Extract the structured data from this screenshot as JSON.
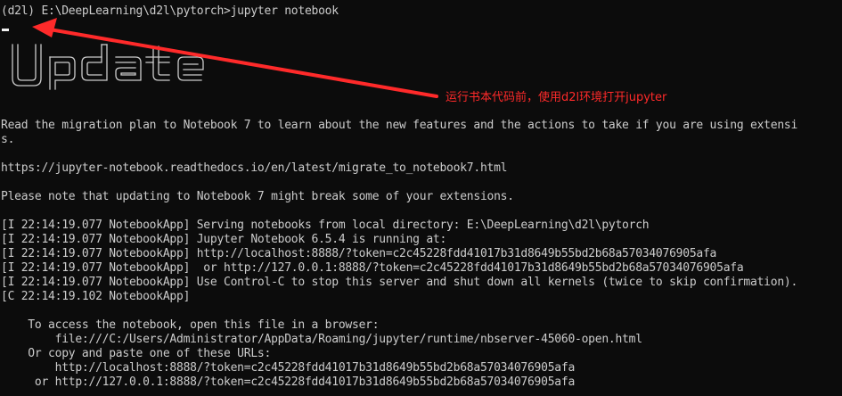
{
  "terminal": {
    "lines": {
      "prompt": "(d2l) E:\\DeepLearning\\d2l\\pytorch>jupyter notebook",
      "migration_1": "Read the migration plan to Notebook 7 to learn about the new features and the actions to take if you are using extensi",
      "migration_2": "s.",
      "docs_url": "https://jupyter-notebook.readthedocs.io/en/latest/migrate_to_notebook7.html",
      "warning": "Please note that updating to Notebook 7 might break some of your extensions.",
      "log_1": "[I 22:14:19.077 NotebookApp] Serving notebooks from local directory: E:\\DeepLearning\\d2l\\pytorch",
      "log_2": "[I 22:14:19.077 NotebookApp] Jupyter Notebook 6.5.4 is running at:",
      "log_3": "[I 22:14:19.077 NotebookApp] http://localhost:8888/?token=c2c45228fdd41017b31d8649b55bd2b68a57034076905afa",
      "log_4": "[I 22:14:19.077 NotebookApp]  or http://127.0.0.1:8888/?token=c2c45228fdd41017b31d8649b55bd2b68a57034076905afa",
      "log_5": "[I 22:14:19.077 NotebookApp] Use Control-C to stop this server and shut down all kernels (twice to skip confirmation).",
      "log_6": "[C 22:14:19.102 NotebookApp]",
      "access_1": "    To access the notebook, open this file in a browser:",
      "access_2": "        file:///C:/Users/Administrator/AppData/Roaming/jupyter/runtime/nbserver-45060-open.html",
      "access_3": "    Or copy and paste one of these URLs:",
      "access_4": "        http://localhost:8888/?token=c2c45228fdd41017b31d8649b55bd2b68a57034076905afa",
      "access_5": "     or http://127.0.0.1:8888/?token=c2c45228fdd41017b31d8649b55bd2b68a57034076905afa"
    },
    "banner_word": "Update"
  },
  "annotation": {
    "text": "运行书本代码前，使用d2l环境打开jupyter",
    "color": "#ff2a2a"
  },
  "colors": {
    "background": "#0c0c0c",
    "foreground": "#cccccc"
  }
}
